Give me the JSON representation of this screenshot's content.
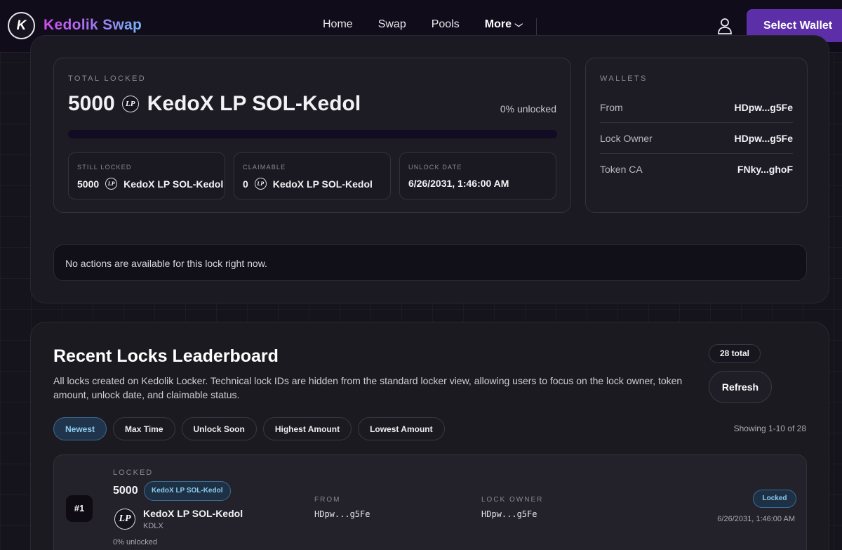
{
  "nav": {
    "logo_glyph": "K",
    "brand": "Kedolik Swap",
    "links": [
      "Home",
      "Swap",
      "Pools",
      "More"
    ],
    "more_chevron": "chevron-down-icon",
    "wallet_button": "Select Wallet"
  },
  "summary": {
    "total_locked_label": "TOTAL LOCKED",
    "amount": "5000",
    "token_badge": "LP",
    "token_name": "KedoX LP SOL-Kedol",
    "unlocked_text": "0% unlocked",
    "unlocked_fraction": 0,
    "still_locked": {
      "label": "STILL LOCKED",
      "amount": "5000",
      "token": "KedoX LP SOL-Kedol"
    },
    "claimable": {
      "label": "CLAIMABLE",
      "amount": "0",
      "token": "KedoX LP SOL-Kedol"
    },
    "unlock_date": {
      "label": "UNLOCK DATE",
      "value": "6/26/2031, 1:46:00 AM"
    }
  },
  "wallets": {
    "title": "WALLETS",
    "rows": [
      {
        "label": "From",
        "value": "HDpw...g5Fe"
      },
      {
        "label": "Lock Owner",
        "value": "HDpw...g5Fe"
      },
      {
        "label": "Token CA",
        "value": "FNky...ghoF"
      }
    ]
  },
  "notice": "No actions are available for this lock right now.",
  "leaderboard": {
    "title": "Recent Locks Leaderboard",
    "description": "All locks created on Kedolik Locker. Technical lock IDs are hidden from the standard locker view, allowing users to focus on the lock owner, token amount, unlock date, and claimable status.",
    "total": "28 total",
    "refresh": "Refresh",
    "filters": [
      "Newest",
      "Max Time",
      "Unlock Soon",
      "Highest Amount",
      "Lowest Amount"
    ],
    "active_filter": "Newest",
    "showing": "Showing 1-10 of 28",
    "rows": [
      {
        "rank": "#1",
        "locked_label": "LOCKED",
        "amount": "5000",
        "tag": "KedoX LP SOL-Kedol",
        "token_badge": "LP",
        "token_name": "KedoX LP SOL-Kedol",
        "token_symbol": "KDLX",
        "unlocked": "0% unlocked",
        "from_label": "FROM",
        "from": "HDpw...g5Fe",
        "owner_label": "LOCK OWNER",
        "owner": "HDpw...g5Fe",
        "status": "Locked",
        "date": "6/26/2031, 1:46:00 AM"
      }
    ]
  },
  "colors": {
    "accent_purple": "#5c2fa8",
    "accent_blue": "#8ecbf2",
    "background": "#15131b"
  }
}
